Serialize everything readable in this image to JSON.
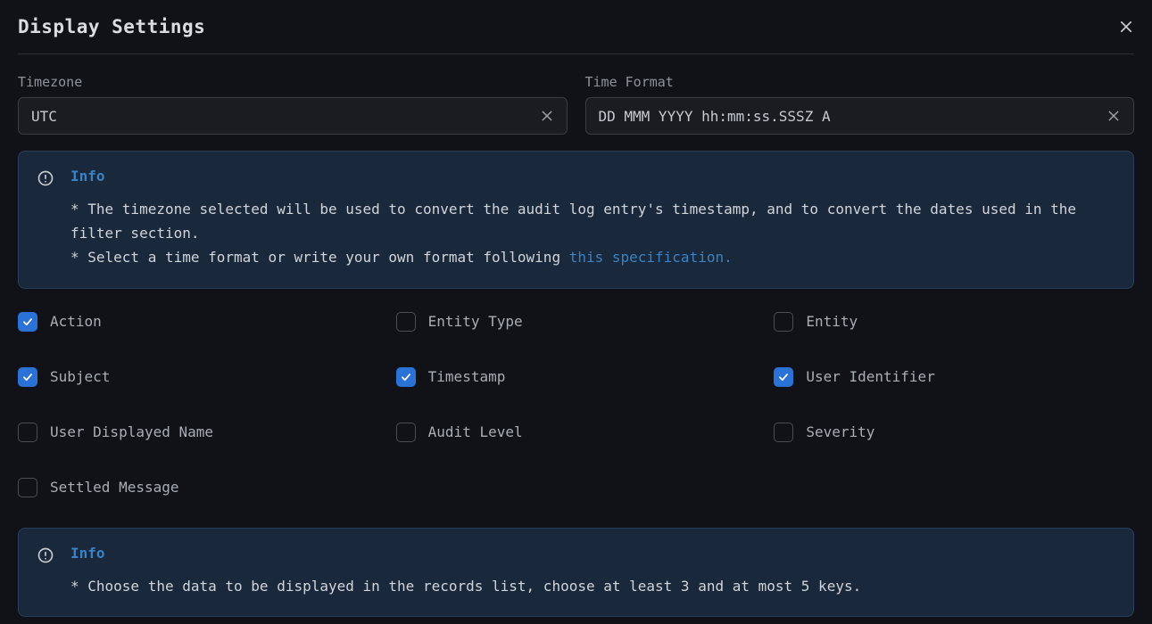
{
  "header": {
    "title": "Display Settings"
  },
  "timezone": {
    "label": "Timezone",
    "value": "UTC"
  },
  "timeformat": {
    "label": "Time Format",
    "value": "DD MMM YYYY hh:mm:ss.SSSZ A"
  },
  "info1": {
    "title": "Info",
    "line1": "* The timezone selected will be used to convert the audit log entry's timestamp, and to convert the dates used in the filter section.",
    "line2_prefix": "* Select a time format or write your own format following ",
    "line2_link": "this specification."
  },
  "checks": [
    {
      "label": "Action",
      "checked": true
    },
    {
      "label": "Entity Type",
      "checked": false
    },
    {
      "label": "Entity",
      "checked": false
    },
    {
      "label": "Subject",
      "checked": true
    },
    {
      "label": "Timestamp",
      "checked": true
    },
    {
      "label": "User Identifier",
      "checked": true
    },
    {
      "label": "User Displayed Name",
      "checked": false
    },
    {
      "label": "Audit Level",
      "checked": false
    },
    {
      "label": "Severity",
      "checked": false
    },
    {
      "label": "Settled Message",
      "checked": false
    }
  ],
  "info2": {
    "title": "Info",
    "body": "* Choose the data to be displayed in the records list, choose at least 3 and at most 5 keys."
  }
}
